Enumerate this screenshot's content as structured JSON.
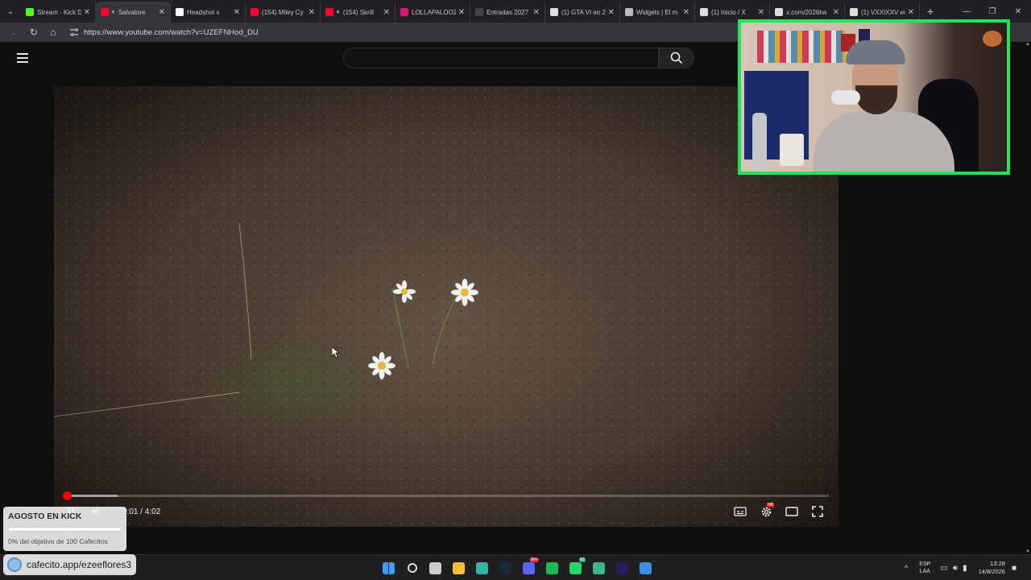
{
  "browser": {
    "tabs": [
      {
        "title": "Stream - Kick D",
        "favicon": "kick-icon",
        "color": "#53fc18",
        "active": false
      },
      {
        "title": "Salvatore",
        "favicon": "youtube-icon",
        "color": "#ff0033",
        "active": true,
        "audio": true
      },
      {
        "title": "Headshot x",
        "favicon": "m-icon",
        "color": "#ffffff",
        "active": false
      },
      {
        "title": "(154) Miley Cy",
        "favicon": "youtube-icon",
        "color": "#ff0033",
        "active": false
      },
      {
        "title": "(154) Skrill",
        "favicon": "youtube-icon",
        "color": "#ff0033",
        "active": false,
        "audio": true
      },
      {
        "title": "LOLLAPALOOZ",
        "favicon": "lolla-icon",
        "color": "#e0146e",
        "active": false
      },
      {
        "title": "Entradas 2027",
        "favicon": "ticket-icon",
        "color": "#444444",
        "active": false
      },
      {
        "title": "(1) GTA VI en 2",
        "favicon": "x-icon",
        "color": "#dddddd",
        "active": false
      },
      {
        "title": "Widgets | El m",
        "favicon": "widget-icon",
        "color": "#bbbbbb",
        "active": false
      },
      {
        "title": "(1) Inicio / X",
        "favicon": "x-icon",
        "color": "#dddddd",
        "active": false
      },
      {
        "title": "x.com/2026ha",
        "favicon": "x-icon",
        "color": "#dddddd",
        "active": false
      },
      {
        "title": "(1) VXXIXXV en",
        "favicon": "x-icon",
        "color": "#dddddd",
        "active": false
      }
    ],
    "url": "https://www.youtube.com/watch?v=UZEFNHod_DU"
  },
  "youtube": {
    "search_placeholder": "",
    "player": {
      "current_time": "0:01",
      "duration": "4:02",
      "time_display": "0:01 / 4:02",
      "progress_fraction": 0.004,
      "buffer_fraction": 0.07,
      "quality_badge": "HD"
    }
  },
  "goal_widget": {
    "title": "AGOSTO EN KICK",
    "progress_percent": 0,
    "text": "0% del objetivo de 100 Cafecitos"
  },
  "cafecito_widget": {
    "label": "cafecito.app/ezeeflores3"
  },
  "taskbar": {
    "icons": [
      {
        "name": "start-icon",
        "color": "#3aa0f0"
      },
      {
        "name": "search-icon",
        "color": "#dddddd"
      },
      {
        "name": "task-view-icon",
        "color": "#cccccc"
      },
      {
        "name": "file-explorer-icon",
        "color": "#f2c13b"
      },
      {
        "name": "edge-icon",
        "color": "#2fb5a0"
      },
      {
        "name": "steam-icon",
        "color": "#1b2838"
      },
      {
        "name": "discord-icon",
        "color": "#5865f2",
        "badge": "99+"
      },
      {
        "name": "spotify-icon",
        "color": "#1db954"
      },
      {
        "name": "whatsapp-icon",
        "color": "#25d366",
        "badge": "65"
      },
      {
        "name": "edge-dev-icon",
        "color": "#3bb58a"
      },
      {
        "name": "premiere-icon",
        "color": "#2a1a5e"
      },
      {
        "name": "app-icon",
        "color": "#3a8ee6"
      }
    ],
    "lang_top": "ESP",
    "lang_bottom": "LAA",
    "time": "13:28",
    "date": "14/8/2026"
  }
}
